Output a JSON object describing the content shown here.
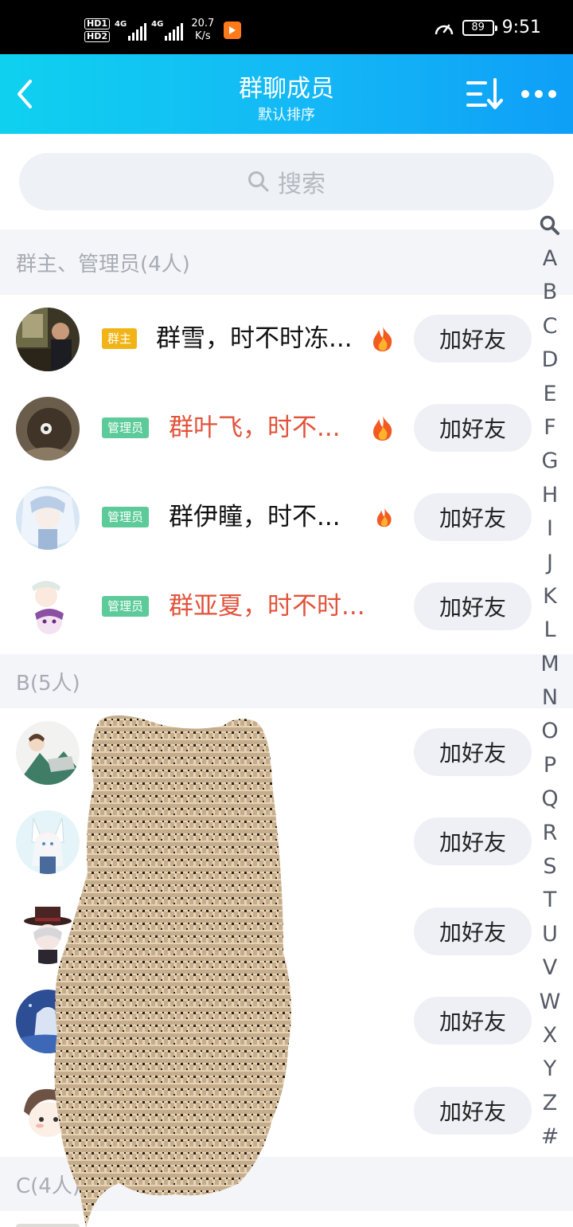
{
  "status_bar": {
    "hd1": "HD1",
    "hd2": "HD2",
    "net1": "4G",
    "net2": "4G",
    "speed_value": "20.7",
    "speed_unit": "K/s",
    "battery": "89",
    "time": "9:51"
  },
  "header": {
    "title": "群聊成员",
    "subtitle": "默认排序"
  },
  "search": {
    "placeholder": "搜索"
  },
  "sections": [
    {
      "label": "群主、管理员(4人)"
    },
    {
      "label": "B(5人)"
    },
    {
      "label": "C(4人)"
    }
  ],
  "members": [
    {
      "badge": "群主",
      "name": "群雪，时不时冻...",
      "name_color": "#111111",
      "flame": "large",
      "action": "加好友"
    },
    {
      "badge": "管理员",
      "name": "群叶飞，时不...",
      "name_color": "#e2533b",
      "flame": "large",
      "action": "加好友"
    },
    {
      "badge": "管理员",
      "name": "群伊瞳，时不...",
      "name_color": "#111111",
      "flame": "small",
      "action": "加好友"
    },
    {
      "badge": "管理员",
      "name": "群亚夏，时不时...",
      "name_color": "#e2533b",
      "flame": "none",
      "action": "加好友"
    }
  ],
  "b_members": [
    {
      "action": "加好友"
    },
    {
      "action": "加好友"
    },
    {
      "action": "加好友"
    },
    {
      "action": "加好友"
    },
    {
      "action": "加好友"
    }
  ],
  "index_letters": [
    "A",
    "B",
    "C",
    "D",
    "E",
    "F",
    "G",
    "H",
    "I",
    "J",
    "K",
    "L",
    "M",
    "N",
    "O",
    "P",
    "Q",
    "R",
    "S",
    "T",
    "U",
    "V",
    "W",
    "X",
    "Y",
    "Z",
    "#"
  ],
  "colors": {
    "header_start": "#0fd1ef",
    "header_end": "#0e9ff7",
    "owner_badge": "#f0b417",
    "admin_badge": "#5ccb99",
    "highlight_name": "#e2533b"
  }
}
